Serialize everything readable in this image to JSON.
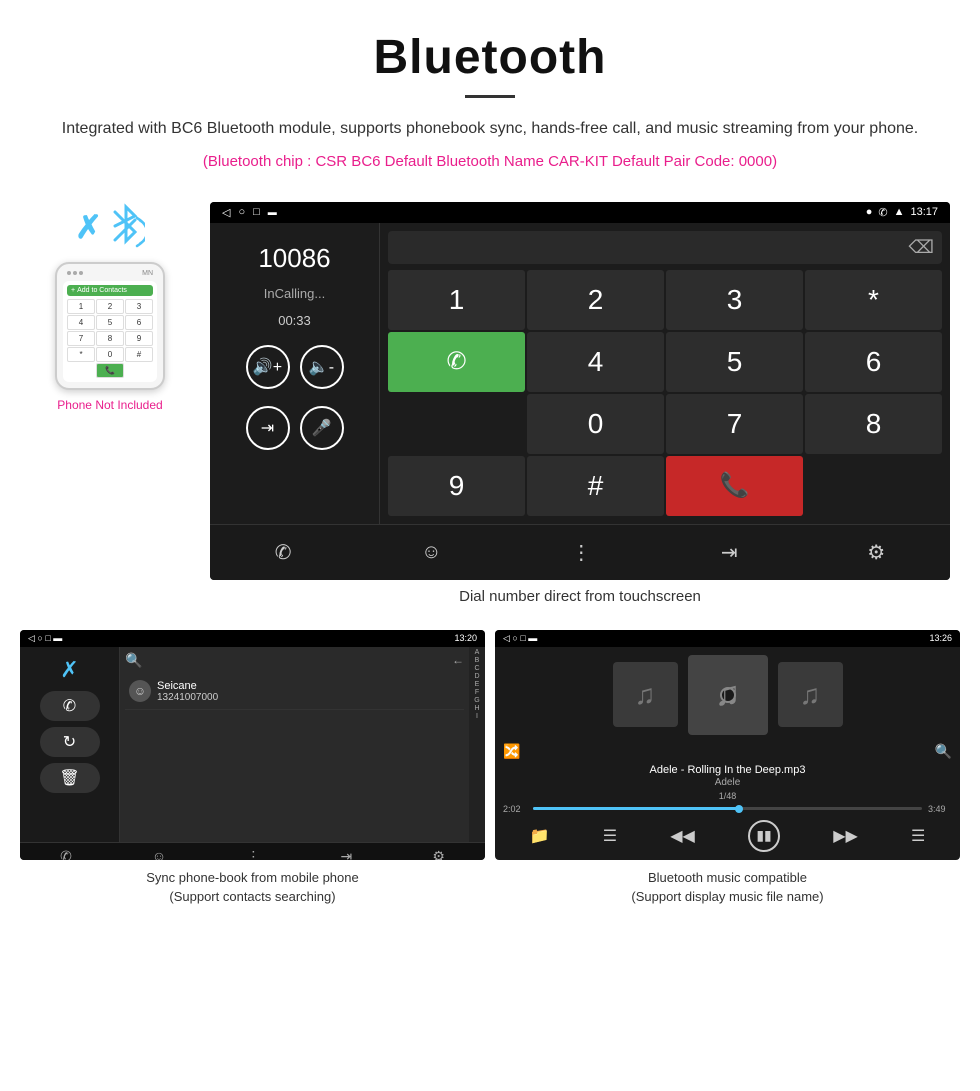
{
  "header": {
    "title": "Bluetooth",
    "description": "Integrated with BC6 Bluetooth module, supports phonebook sync, hands-free call, and music streaming from your phone.",
    "specs": "(Bluetooth chip : CSR BC6    Default Bluetooth Name CAR-KIT    Default Pair Code: 0000)"
  },
  "phone": {
    "not_included": "Phone Not Included"
  },
  "dialer": {
    "number": "10086",
    "status": "InCalling...",
    "timer": "00:33",
    "time": "13:17",
    "caption": "Dial number direct from touchscreen"
  },
  "phonebook": {
    "time": "13:20",
    "contact_name": "Seicane",
    "contact_number": "13241007000",
    "caption_line1": "Sync phone-book from mobile phone",
    "caption_line2": "(Support contacts searching)"
  },
  "music": {
    "time": "13:26",
    "song": "Adele - Rolling In the Deep.mp3",
    "artist": "Adele",
    "track_info": "1/48",
    "time_current": "2:02",
    "time_total": "3:49",
    "caption_line1": "Bluetooth music compatible",
    "caption_line2": "(Support display music file name)"
  }
}
